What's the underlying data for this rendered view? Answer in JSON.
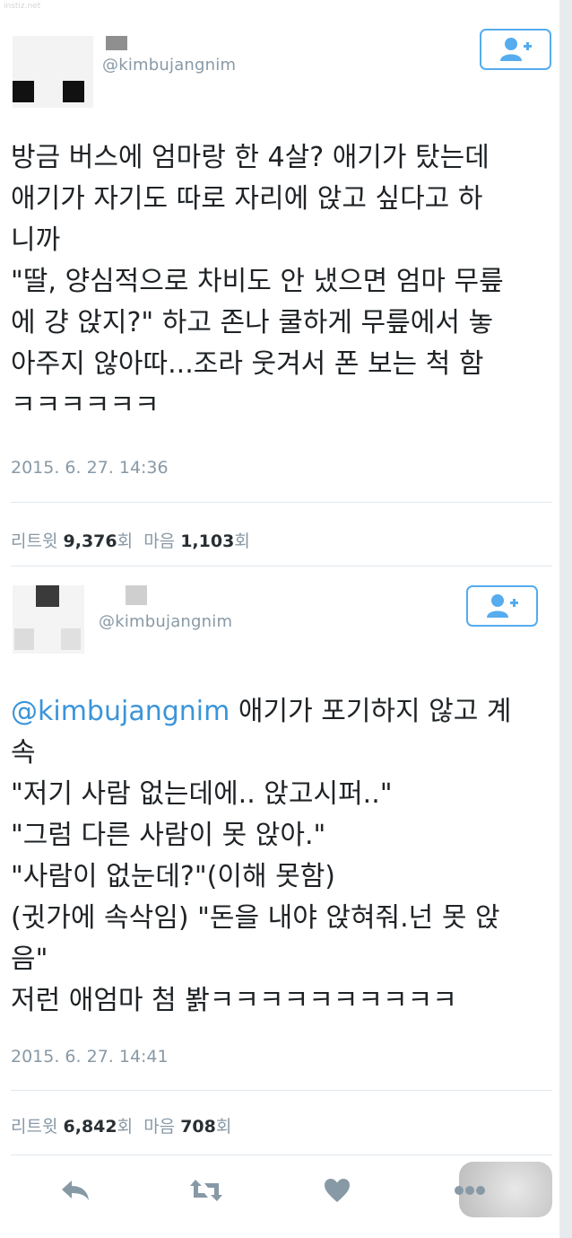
{
  "watermark": "instiz.net",
  "tweets": [
    {
      "handle": "@kimbujangnim",
      "text": "방금 버스에 엄마랑 한 4살? 애기가 탔는데\n애기가 자기도 따로 자리에 앉고 싶다고 하\n니까\n\"딸, 양심적으로 차비도 안 냈으면 엄마 무릎\n에 걍 앉지?\" 하고 존나 쿨하게 무릎에서 놓\n아주지 않아따...조라 웃겨서 폰 보는 척 함\nㅋㅋㅋㅋㅋㅋ",
      "timestamp": "2015. 6. 27. 14:36",
      "retweet_label": "리트윗",
      "retweet_count": "9,376",
      "count_suffix": "회",
      "like_label": "마음",
      "like_count": "1,103"
    },
    {
      "handle": "@kimbujangnim",
      "mention": "@kimbujangnim",
      "text": " 애기가 포기하지 않고 계\n속\n\"저기 사람 없는데에.. 앉고시퍼..\"\n\"그럼 다른 사람이 못 앉아.\"\n\"사람이 없눈데?\"(이해 못함)\n(귓가에 속삭임) \"돈을 내야 앉혀줘.넌 못 앉\n음\"\n저런 애엄마 첨 봙ㅋㅋㅋㅋㅋㅋㅋㅋㅋㅋ",
      "timestamp": "2015. 6. 27. 14:41",
      "retweet_label": "리트윗",
      "retweet_count": "6,842",
      "count_suffix": "회",
      "like_label": "마음",
      "like_count": "708"
    }
  ],
  "icons": {
    "follow": "follow-user-icon",
    "reply": "reply-icon",
    "retweet": "retweet-icon",
    "like": "heart-icon",
    "more": "more-dots-icon"
  },
  "colors": {
    "accent": "#55acee",
    "mention": "#3b94d9",
    "meta": "#8899a6",
    "action_icon": "#8899a6"
  }
}
